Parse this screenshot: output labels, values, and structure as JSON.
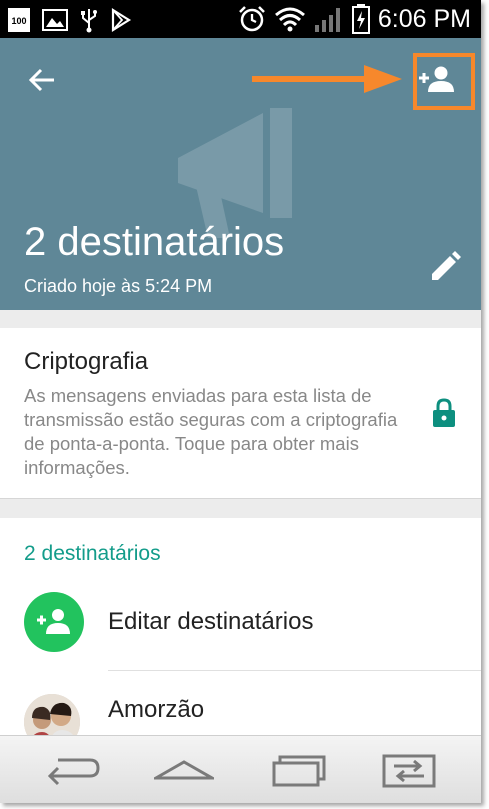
{
  "status_bar": {
    "battery_saver_label": "100",
    "time": "6:06 PM"
  },
  "header": {
    "title": "2 destinatários",
    "subtitle": "Criado hoje às 5:24 PM",
    "back_icon": "arrow-left",
    "add_icon": "person-add",
    "edit_icon": "pencil",
    "highlight_color": "#f7882c",
    "background_color": "#5f8797"
  },
  "encryption": {
    "title": "Criptografia",
    "description": "As mensagens enviadas para esta lista de transmissão estão seguras com a criptografia de ponta-a-ponta. Toque para obter mais informações.",
    "icon": "lock",
    "accent_color": "#0d8f7f"
  },
  "recipients": {
    "header": "2 destinatários",
    "edit_label": "Editar destinatários",
    "edit_icon": "person-add",
    "edit_color": "#22c35e",
    "contacts": [
      {
        "name": "Amorzão"
      }
    ]
  },
  "nav": {
    "back_icon": "back",
    "home_icon": "home",
    "recents_icon": "recents",
    "switch_icon": "dual-window"
  }
}
